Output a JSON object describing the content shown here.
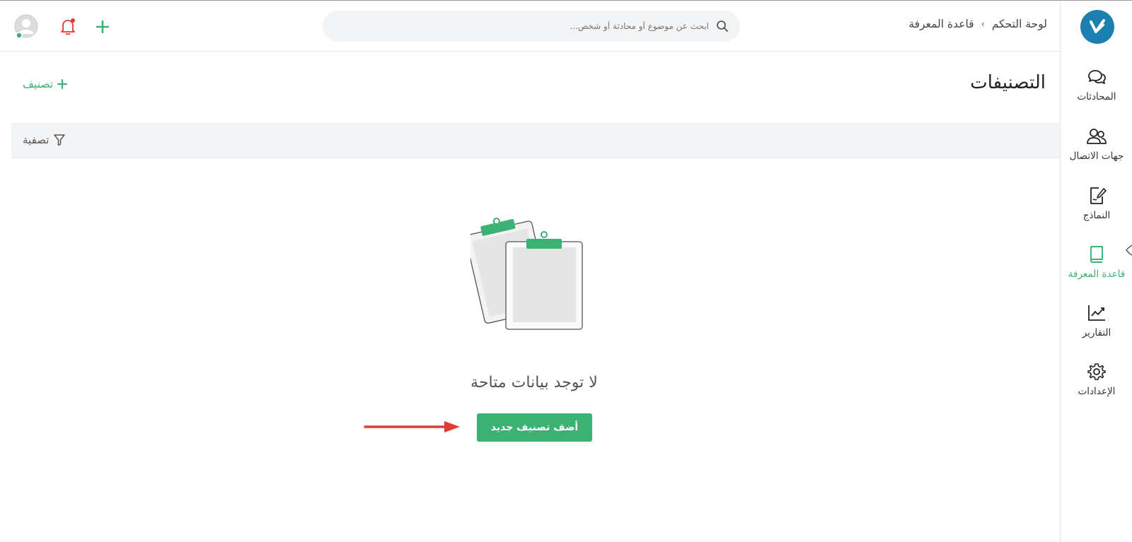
{
  "header": {
    "breadcrumb": [
      "لوحة التحكم",
      "قاعدة المعرفة"
    ],
    "breadcrumb_separator": "›",
    "search_placeholder": "ابحث عن موضوع أو محادثة أو شخص..."
  },
  "sidebar": {
    "items": [
      {
        "label": "المحادثات",
        "icon": "chat-icon",
        "active": false
      },
      {
        "label": "جهات الاتصال",
        "icon": "contacts-icon",
        "active": false
      },
      {
        "label": "النماذج",
        "icon": "forms-icon",
        "active": false
      },
      {
        "label": "قاعدة المعرفة",
        "icon": "book-icon",
        "active": true
      },
      {
        "label": "التقارير",
        "icon": "reports-icon",
        "active": false
      },
      {
        "label": "الإعدادات",
        "icon": "gear-icon",
        "active": false
      }
    ]
  },
  "main": {
    "title": "التصنيفات",
    "add_link": "تصنيف",
    "filter_label": "تصفية",
    "empty_text": "لا توجد بيانات متاحة",
    "add_button": "أضف تصنيف جديد"
  },
  "colors": {
    "accent": "#3bb273",
    "brand": "#1b7fb0",
    "notification": "#e53935",
    "annotation_arrow": "#e53935"
  }
}
